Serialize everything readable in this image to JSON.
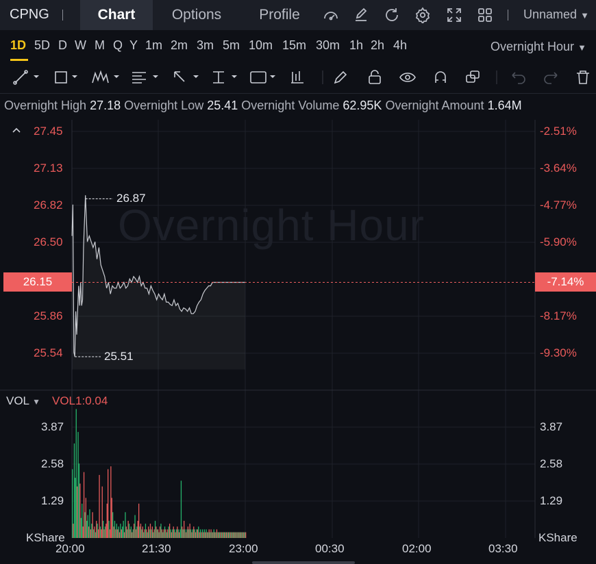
{
  "header": {
    "symbol": "CPNG",
    "tabs": [
      {
        "label": "Chart",
        "active": true
      },
      {
        "label": "Options",
        "active": false
      },
      {
        "label": "Profile",
        "active": false
      }
    ],
    "icons": [
      "gauge-icon",
      "edit-icon",
      "refresh-icon",
      "settings-icon",
      "fullscreen-icon",
      "grid-layout-icon"
    ],
    "layout_name": "Unnamed"
  },
  "timeframes": {
    "items": [
      "1D",
      "5D",
      "D",
      "W",
      "M",
      "Q",
      "Y",
      "1m",
      "2m",
      "3m",
      "5m",
      "10m",
      "15m",
      "30m",
      "1h",
      "2h",
      "4h"
    ],
    "active": "1D",
    "session": "Overnight Hour"
  },
  "drawing_tools": [
    "trend-line-icon",
    "rectangle-icon",
    "pattern-icon",
    "fibonacci-icon",
    "arrow-icon",
    "measure-icon",
    "text-icon",
    "candle-icon",
    "pencil-icon",
    "unlock-icon",
    "eye-icon",
    "magnet-icon",
    "link-icon",
    "undo-icon",
    "redo-icon",
    "trash-icon"
  ],
  "stats": {
    "high_label": "Overnight High",
    "high": "27.18",
    "low_label": "Overnight Low",
    "low": "25.41",
    "volume_label": "Overnight Volume",
    "volume": "62.95K",
    "amount_label": "Overnight Amount",
    "amount": "1.64M"
  },
  "colors": {
    "up": "#26b36b",
    "down": "#e55b5b",
    "accent": "#f5c518",
    "price_line": "#c9cbd1"
  },
  "chart_data": {
    "type": "line",
    "watermark": "Overnight Hour",
    "price_axis_left": [
      "27.45",
      "27.13",
      "26.82",
      "26.50",
      "26.15",
      "25.86",
      "25.54"
    ],
    "price_axis_right": [
      "-2.51%",
      "-3.64%",
      "-4.77%",
      "-5.90%",
      "-7.14%",
      "-8.17%",
      "-9.30%"
    ],
    "current_price": "26.15",
    "current_change": "-7.14%",
    "high_marker": "26.87",
    "low_marker": "25.51",
    "ylim": [
      25.4,
      27.55
    ],
    "x_labels": [
      "20:00",
      "21:30",
      "23:00",
      "00:30",
      "02:00",
      "03:30"
    ],
    "series": [
      {
        "x": [
          0,
          1,
          2,
          3,
          4,
          5,
          6,
          7,
          8,
          9,
          10,
          11,
          12,
          14,
          16,
          18,
          20,
          22,
          24,
          26,
          28,
          30,
          32,
          34,
          36,
          38,
          40,
          42,
          44,
          46,
          48,
          50,
          52,
          54,
          56,
          58,
          60,
          62,
          64,
          66,
          68,
          70,
          72,
          74,
          76,
          78,
          80,
          82,
          84,
          86,
          88,
          90,
          92,
          94,
          96,
          98,
          100,
          102,
          104,
          106,
          108,
          110,
          112,
          114,
          116,
          118,
          120,
          122,
          124,
          126,
          128,
          130,
          132,
          134,
          136,
          138,
          140,
          142,
          144,
          146,
          148,
          150,
          152,
          154,
          156,
          158,
          160,
          162,
          164,
          166,
          168,
          170,
          172,
          174,
          176,
          178,
          180
        ],
        "values": [
          26.55,
          26.82,
          25.55,
          25.51,
          25.9,
          25.7,
          25.92,
          26.12,
          25.95,
          26.15,
          25.95,
          26.0,
          26.45,
          26.9,
          26.5,
          26.55,
          26.5,
          26.45,
          26.5,
          26.35,
          26.45,
          26.3,
          26.25,
          26.2,
          26.1,
          26.15,
          26.05,
          26.12,
          26.1,
          26.1,
          26.15,
          26.1,
          26.12,
          26.15,
          26.1,
          26.12,
          26.18,
          26.15,
          26.2,
          26.18,
          26.15,
          26.2,
          26.12,
          26.15,
          26.1,
          26.1,
          26.05,
          26.12,
          26.08,
          26.05,
          26.0,
          26.05,
          26.02,
          26.0,
          26.05,
          25.98,
          25.98,
          25.96,
          25.95,
          26.0,
          25.95,
          25.97,
          25.92,
          25.9,
          25.93,
          25.92,
          25.9,
          25.93,
          25.88,
          25.88,
          25.9,
          25.95,
          25.98,
          26.0,
          26.05,
          26.08,
          26.1,
          26.12,
          26.12,
          26.15,
          26.15,
          26.15,
          26.15,
          26.15,
          26.15,
          26.15,
          26.15,
          26.15,
          26.15,
          26.15,
          26.15,
          26.15,
          26.15,
          26.15,
          26.15,
          26.15,
          26.15
        ]
      }
    ],
    "volume": {
      "title": "VOL",
      "indicator": "VOL1:0.04",
      "axis_labels": [
        "3.87",
        "2.58",
        "1.29"
      ],
      "unit": "KShare",
      "ylim": [
        0,
        5.0
      ],
      "x": [
        0,
        1,
        2,
        3,
        4,
        5,
        6,
        7,
        8,
        9,
        10,
        11,
        12,
        13,
        14,
        15,
        16,
        17,
        18,
        19,
        20,
        21,
        22,
        23,
        24,
        25,
        26,
        27,
        28,
        29,
        30,
        31,
        32,
        33,
        34,
        35,
        36,
        37,
        38,
        39,
        40,
        41,
        42,
        43,
        44,
        45,
        46,
        47,
        48,
        49,
        50,
        51,
        52,
        53,
        54,
        55,
        56,
        57,
        58,
        59,
        60,
        61,
        62,
        63,
        64,
        65,
        66,
        67,
        68,
        69,
        70,
        71,
        72,
        73,
        74,
        75,
        76,
        77,
        78,
        79,
        80,
        81,
        82,
        83,
        84,
        85,
        86,
        87,
        88,
        89,
        90,
        91,
        92,
        93,
        94,
        95,
        96,
        97,
        98,
        99,
        100,
        101,
        102,
        103,
        104,
        105,
        106,
        107,
        108,
        109,
        110,
        111,
        112,
        113,
        114,
        115,
        116,
        117,
        118,
        119,
        120,
        121,
        122,
        123,
        124,
        125,
        126,
        127,
        128,
        129,
        130,
        131,
        132,
        133,
        134,
        135,
        136,
        137,
        138,
        139,
        140,
        141,
        142,
        143,
        144,
        145,
        146,
        147,
        148,
        149,
        150,
        151,
        152,
        153,
        154,
        155,
        156,
        157,
        158,
        159,
        160,
        161,
        162,
        163,
        164,
        165,
        166,
        167,
        168,
        169,
        170,
        171,
        172,
        173,
        174,
        175,
        176,
        177,
        178,
        179,
        180
      ],
      "values": [
        2.4,
        0.5,
        3.3,
        2.1,
        4.5,
        1.8,
        3.7,
        2.6,
        1.9,
        0.7,
        1.2,
        0.4,
        2.3,
        0.9,
        1.4,
        0.6,
        0.8,
        0.4,
        1.0,
        0.3,
        0.5,
        0.9,
        0.3,
        0.4,
        0.2,
        0.6,
        0.5,
        0.3,
        2.2,
        0.4,
        0.3,
        1.8,
        0.6,
        0.3,
        0.4,
        0.5,
        1.2,
        2.4,
        0.6,
        0.3,
        2.5,
        1.4,
        0.9,
        0.4,
        0.6,
        0.3,
        0.5,
        0.3,
        0.4,
        0.2,
        0.5,
        0.3,
        0.4,
        0.6,
        0.2,
        0.9,
        0.4,
        0.3,
        0.6,
        0.5,
        0.3,
        0.4,
        0.2,
        0.3,
        0.5,
        0.8,
        0.3,
        0.4,
        0.6,
        1.2,
        0.4,
        0.5,
        0.3,
        0.4,
        0.2,
        0.3,
        0.5,
        0.3,
        0.2,
        0.4,
        0.3,
        0.5,
        0.3,
        0.4,
        0.2,
        0.3,
        0.6,
        0.4,
        0.3,
        0.3,
        0.2,
        0.4,
        0.5,
        0.3,
        0.2,
        0.3,
        0.4,
        0.3,
        0.2,
        0.3,
        0.4,
        0.5,
        0.3,
        0.2,
        0.3,
        0.4,
        0.3,
        0.2,
        0.3,
        0.4,
        0.3,
        0.2,
        0.3,
        2.0,
        0.4,
        0.3,
        0.6,
        0.3,
        0.2,
        0.3,
        0.4,
        0.3,
        0.5,
        0.3,
        0.2,
        0.3,
        0.4,
        0.3,
        0.2,
        0.3,
        0.3,
        0.4,
        0.2,
        0.3,
        0.2,
        0.3,
        0.2,
        0.3,
        0.2,
        0.3,
        0.2,
        0.2,
        0.3,
        0.2,
        0.3,
        0.2,
        0.2,
        0.3,
        0.2,
        0.2,
        0.3,
        0.2,
        0.2,
        0.2,
        0.2,
        0.2,
        0.2,
        0.2,
        0.2,
        0.2,
        0.2,
        0.2,
        0.2,
        0.2,
        0.2,
        0.2,
        0.2,
        0.2,
        0.2,
        0.2,
        0.2,
        0.2,
        0.2,
        0.2,
        0.2,
        0.2,
        0.2,
        0.2,
        0.2,
        0.2,
        0.2,
        0.2,
        0.2
      ],
      "up": [
        1,
        0,
        1,
        1,
        1,
        0,
        1,
        1,
        0,
        1,
        1,
        0,
        0,
        1,
        0,
        1,
        1,
        0,
        1,
        0,
        1,
        0,
        1,
        0,
        1,
        0,
        1,
        0,
        0,
        1,
        0,
        0,
        1,
        0,
        1,
        0,
        0,
        0,
        1,
        0,
        0,
        0,
        1,
        0,
        1,
        0,
        1,
        0,
        1,
        0,
        1,
        0,
        1,
        1,
        0,
        1,
        0,
        1,
        0,
        1,
        0,
        1,
        0,
        1,
        0,
        1,
        0,
        1,
        0,
        0,
        1,
        0,
        1,
        0,
        1,
        0,
        1,
        0,
        1,
        0,
        1,
        0,
        1,
        0,
        1,
        0,
        1,
        0,
        1,
        0,
        1,
        0,
        1,
        0,
        1,
        0,
        1,
        0,
        1,
        0,
        1,
        0,
        1,
        0,
        1,
        0,
        1,
        0,
        1,
        0,
        1,
        0,
        1,
        1,
        0,
        1,
        0,
        1,
        0,
        1,
        0,
        1,
        0,
        1,
        0,
        1,
        0,
        1,
        0,
        1,
        0,
        1,
        0,
        1,
        0,
        1,
        0,
        1,
        0,
        1,
        0,
        1,
        0,
        1,
        0,
        1,
        0,
        1,
        0,
        1,
        0,
        1,
        0,
        1,
        0,
        1,
        0,
        1,
        0,
        1,
        0,
        1,
        0,
        1,
        0,
        1,
        0,
        1,
        0,
        1,
        0,
        1,
        0,
        1,
        0,
        1,
        0,
        1,
        0,
        1,
        0
      ]
    }
  }
}
